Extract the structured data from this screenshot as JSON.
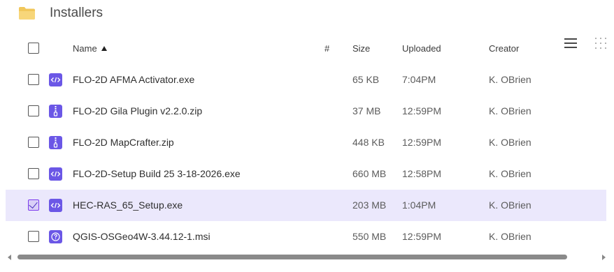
{
  "folder": {
    "title": "Installers",
    "icon": "folder-icon",
    "icon_color": "#f1c75b"
  },
  "columns": {
    "name": "Name",
    "hash": "#",
    "size": "Size",
    "uploaded": "Uploaded",
    "creator": "Creator"
  },
  "sort": {
    "column": "name",
    "direction": "ascending"
  },
  "view_buttons": [
    "list-view-icon",
    "grid-view-icon"
  ],
  "accent_color": "#6b57e6",
  "selected_row_color": "#ebe8fc",
  "files": [
    {
      "name": "FLO-2D AFMA Activator.exe",
      "size": "65 KB",
      "uploaded": "7:04PM",
      "creator": "K. OBrien",
      "icon": "code-file-icon",
      "selected": false
    },
    {
      "name": "FLO-2D Gila Plugin v2.2.0.zip",
      "size": "37 MB",
      "uploaded": "12:59PM",
      "creator": "K. OBrien",
      "icon": "zip-file-icon",
      "selected": false
    },
    {
      "name": "FLO-2D MapCrafter.zip",
      "size": "448 KB",
      "uploaded": "12:59PM",
      "creator": "K. OBrien",
      "icon": "zip-file-icon",
      "selected": false
    },
    {
      "name": "FLO-2D-Setup Build 25 3-18-2026.exe",
      "size": "660 MB",
      "uploaded": "12:58PM",
      "creator": "K. OBrien",
      "icon": "code-file-icon",
      "selected": false
    },
    {
      "name": "HEC-RAS_65_Setup.exe",
      "size": "203 MB",
      "uploaded": "1:04PM",
      "creator": "K. OBrien",
      "icon": "code-file-icon",
      "selected": true
    },
    {
      "name": "QGIS-OSGeo4W-3.44.12-1.msi",
      "size": "550 MB",
      "uploaded": "12:59PM",
      "creator": "K. OBrien",
      "icon": "unknown-file-icon",
      "selected": false
    }
  ]
}
